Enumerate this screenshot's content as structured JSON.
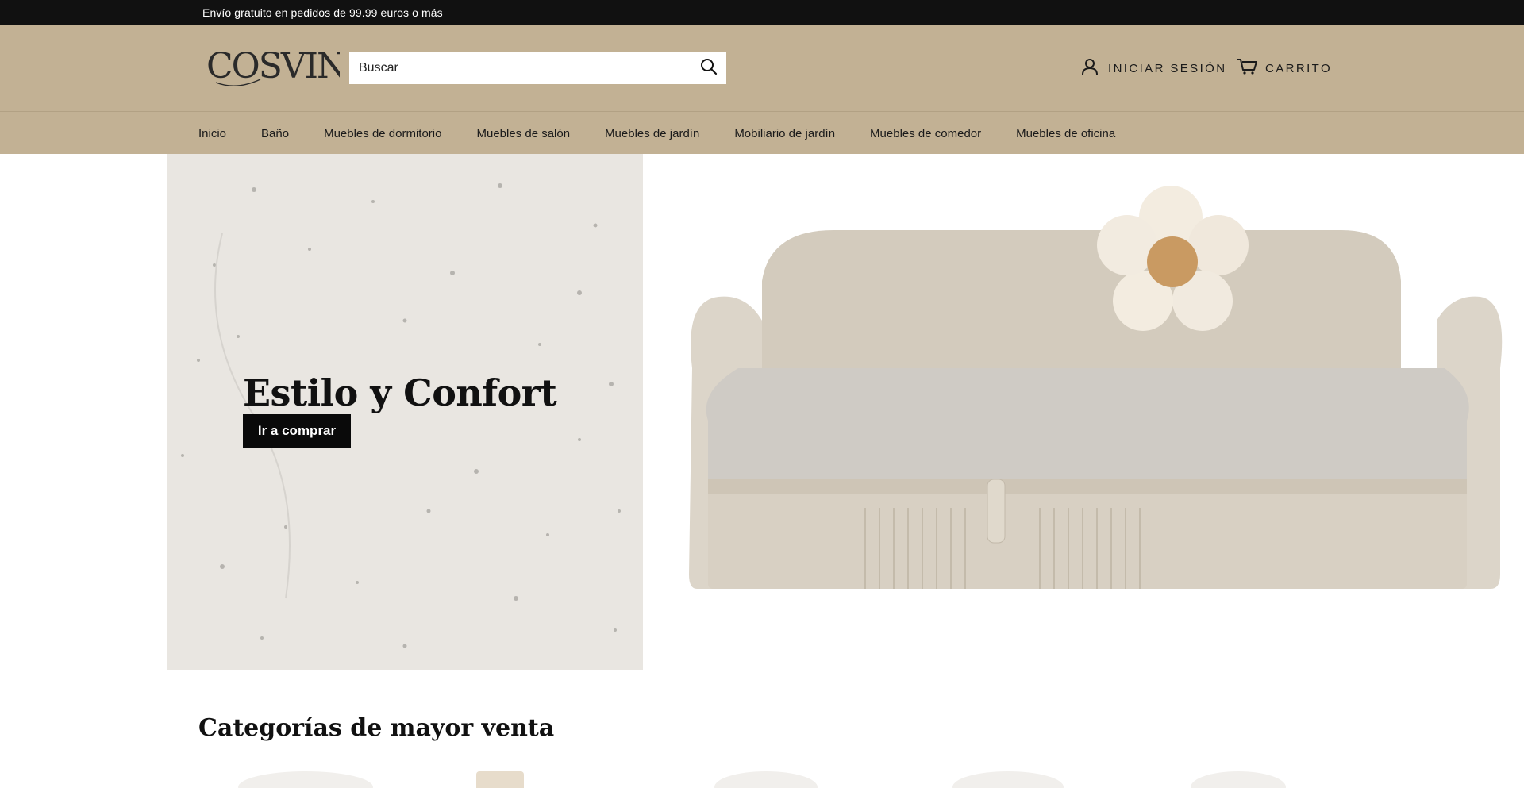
{
  "announcement": {
    "text": "Envío gratuito en pedidos de 99.99 euros o más"
  },
  "header": {
    "logo_text": "COSVINI",
    "search": {
      "placeholder": "Buscar",
      "value": ""
    },
    "account_label": "INICIAR SESIÓN",
    "cart_label": "CARRITO"
  },
  "nav": {
    "items": [
      {
        "label": "Inicio"
      },
      {
        "label": "Baño"
      },
      {
        "label": "Muebles de dormitorio"
      },
      {
        "label": "Muebles de salón"
      },
      {
        "label": "Muebles de jardín"
      },
      {
        "label": "Mobiliario de jardín"
      },
      {
        "label": "Muebles de comedor"
      },
      {
        "label": "Muebles de oficina"
      }
    ]
  },
  "hero": {
    "title": "Estilo y Confort",
    "button_label": "Ir a comprar"
  },
  "sections": {
    "top_categories_title": "Categorías de mayor venta"
  },
  "icons": {
    "search": "search-icon",
    "account": "user-icon",
    "cart": "cart-icon"
  },
  "colors": {
    "announcement_bg": "#111111",
    "header_bg": "#c2b194",
    "hero_panel_bg": "#e9e6e1",
    "button_bg": "#0a0a0a",
    "sofa": "#d6cfc2",
    "pillow": "#f3ece0",
    "pillow_center": "#c99a62"
  }
}
